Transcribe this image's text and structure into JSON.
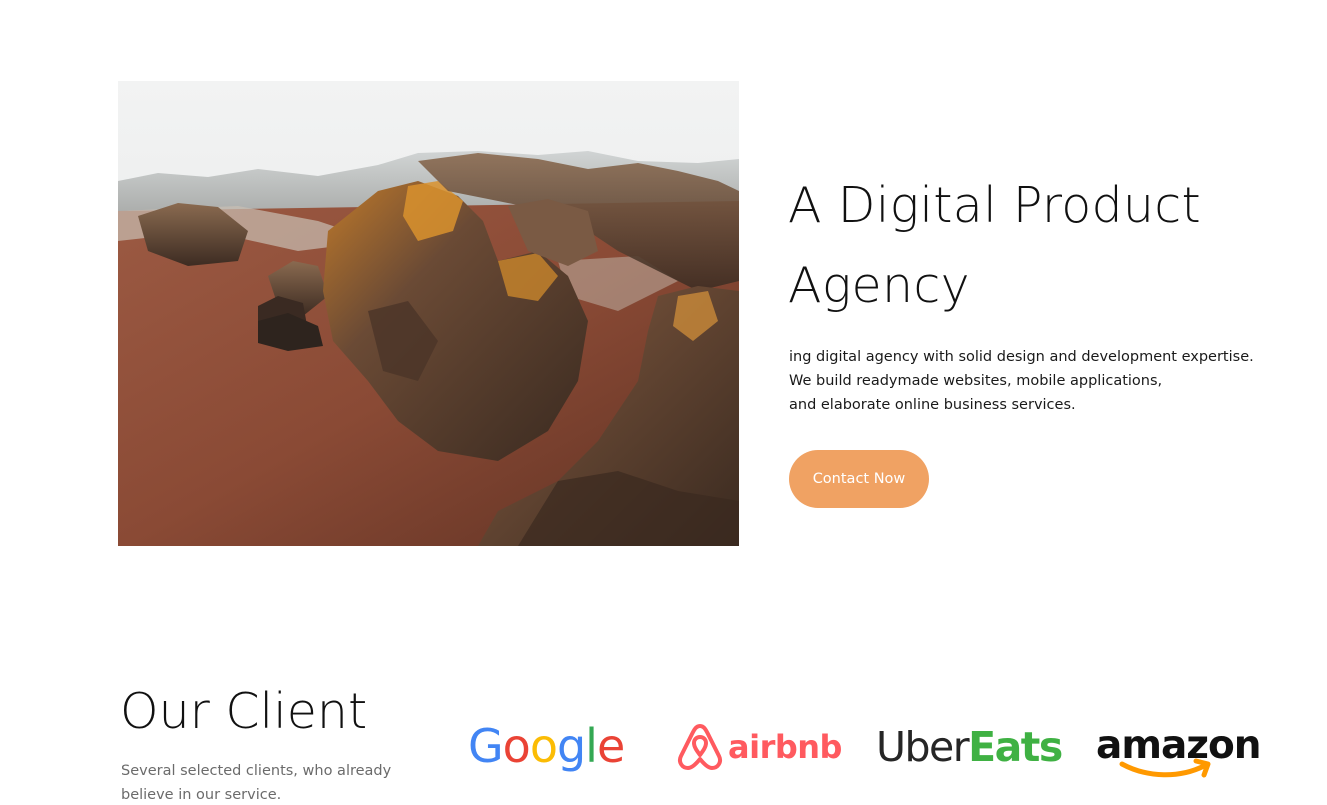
{
  "hero": {
    "image_alt": "Aerial desert rock formations",
    "title_line1": "A Digital Product",
    "title_line2": "Agency",
    "desc_line1": "ing digital agency with solid design and development expertise.",
    "desc_line2": "We build readymade websites, mobile applications,",
    "desc_line3": "and elaborate online business services.",
    "button_label": "Contact Now"
  },
  "clients": {
    "title": "Our Client",
    "desc_line1": "Several selected clients, who already",
    "desc_line2": "believe in our service.",
    "logos": {
      "google": "Google",
      "airbnb": "airbnb",
      "ubereats_a": "Uber",
      "ubereats_b": "Eats",
      "amazon": "amazon"
    }
  },
  "colors": {
    "accent": "#f0a263",
    "google_blue": "#4285f4",
    "google_red": "#ea4335",
    "google_yellow": "#fbbc05",
    "google_green": "#34a853",
    "airbnb": "#ff5a5f",
    "ubereats_green": "#3fb143",
    "amazon_orange": "#ff9900"
  },
  "icons": {
    "airbnb": "airbnb-belo-icon",
    "amazon": "amazon-smile-icon"
  }
}
